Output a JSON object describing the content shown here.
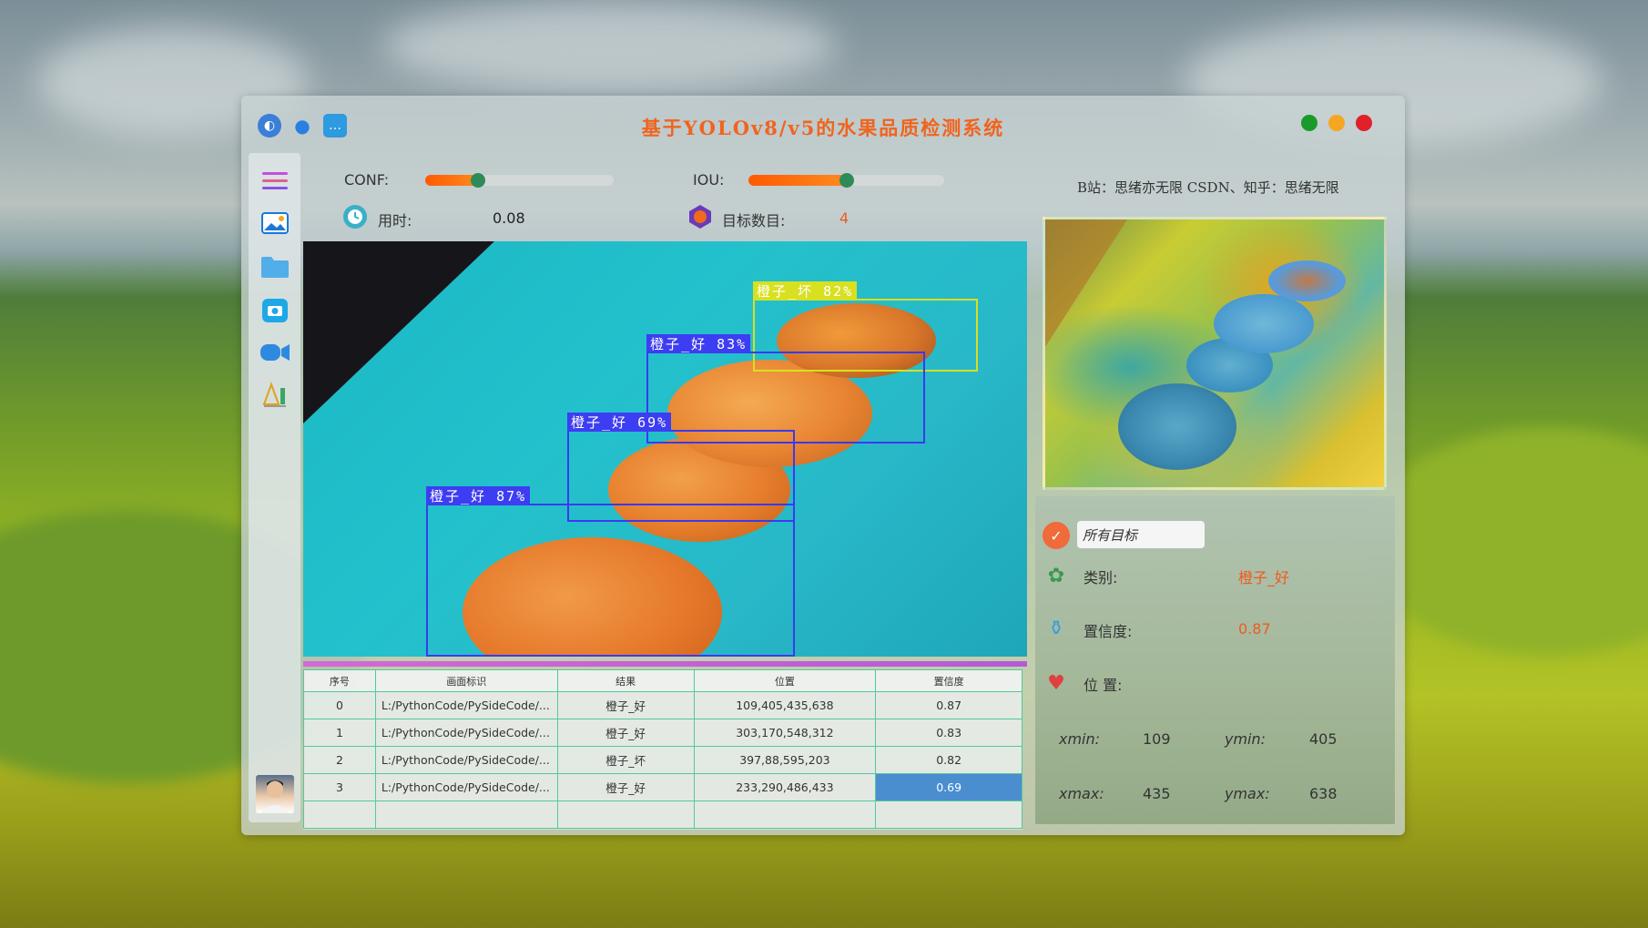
{
  "app": {
    "title": "基于YOLOv8/v5的水果品质检测系统",
    "window_controls": {
      "green": "#1a9a2a",
      "yellow": "#f5a623",
      "red": "#e0202a"
    }
  },
  "header_icons": [
    "globe-icon",
    "user-icon",
    "chat-icon"
  ],
  "sidebar": {
    "items": [
      "menu-icon",
      "image-icon",
      "folder-icon",
      "camera-icon",
      "video-icon",
      "logo-icon"
    ],
    "avatar": "avatar"
  },
  "controls": {
    "conf_label": "CONF:",
    "conf_value": 0.28,
    "iou_label": "IOU:",
    "iou_value": 0.5,
    "time_label": "用时:",
    "time_value": "0.08",
    "count_label": "目标数目:",
    "count_value": "4"
  },
  "detections": [
    {
      "label": "橙子_坏",
      "score": "82%",
      "type": "bad"
    },
    {
      "label": "橙子_好",
      "score": "83%",
      "type": "good"
    },
    {
      "label": "橙子_好",
      "score": "69%",
      "type": "good"
    },
    {
      "label": "橙子_好",
      "score": "87%",
      "type": "good"
    }
  ],
  "table": {
    "headers": [
      "序号",
      "画面标识",
      "结果",
      "位置",
      "置信度"
    ],
    "rows": [
      {
        "id": "0",
        "path": "L:/PythonCode/PySideCode/...",
        "result": "橙子_好",
        "pos": "109,405,435,638",
        "conf": "0.87"
      },
      {
        "id": "1",
        "path": "L:/PythonCode/PySideCode/...",
        "result": "橙子_好",
        "pos": "303,170,548,312",
        "conf": "0.83"
      },
      {
        "id": "2",
        "path": "L:/PythonCode/PySideCode/...",
        "result": "橙子_坏",
        "pos": "397,88,595,203",
        "conf": "0.82"
      },
      {
        "id": "3",
        "path": "L:/PythonCode/PySideCode/...",
        "result": "橙子_好",
        "pos": "233,290,486,433",
        "conf": "0.69"
      }
    ]
  },
  "right": {
    "credit": "B站：思绪亦无限  CSDN、知乎：思绪无限",
    "target_select": "所有目标",
    "class_label": "类别:",
    "class_value": "橙子_好",
    "conf_label": "置信度:",
    "conf_value": "0.87",
    "pos_label": "位 置:",
    "xmin_label": "xmin:",
    "xmin": "109",
    "ymin_label": "ymin:",
    "ymin": "405",
    "xmax_label": "xmax:",
    "xmax": "435",
    "ymax_label": "ymax:",
    "ymax": "638"
  },
  "colors": {
    "accent": "#f0641e",
    "value_orange": "#f05a1e",
    "box_good": "#3d3df2",
    "box_bad": "#d8e020",
    "table_border": "#52c8a0"
  }
}
